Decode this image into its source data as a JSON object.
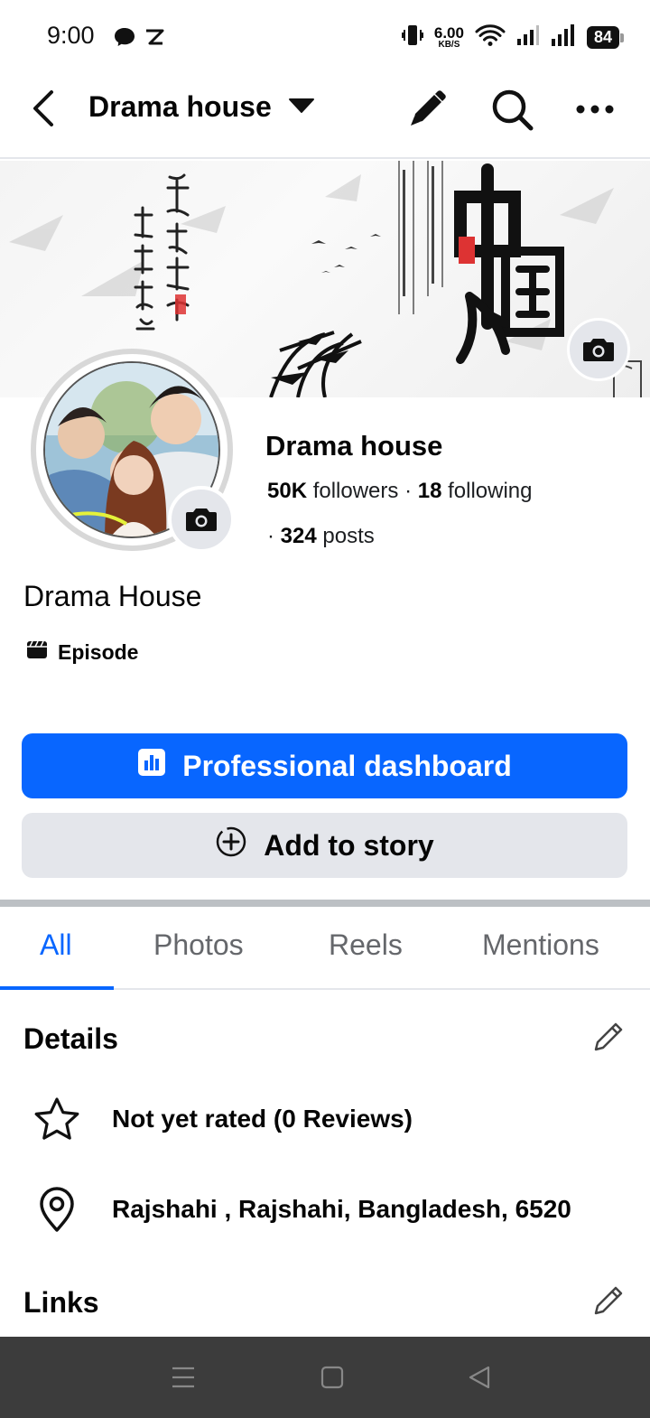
{
  "status_bar": {
    "time": "9:00",
    "net_speed": "6.00",
    "net_unit": "KB/S",
    "battery": "84"
  },
  "app_bar": {
    "title": "Drama house",
    "icons": [
      "back-icon",
      "caret-down-icon",
      "pencil-icon",
      "search-icon",
      "more-icon"
    ]
  },
  "profile": {
    "name": "Drama house",
    "followers_count": "50K",
    "followers_label": " followers · ",
    "following_count": "18",
    "following_label": " following",
    "posts_prefix": "· ",
    "posts_count": "324",
    "posts_label": " posts",
    "display_name": "Drama House",
    "category": "Episode"
  },
  "actions": {
    "primary": "Professional dashboard",
    "secondary": "Add to story"
  },
  "tabs": [
    {
      "label": "All",
      "active": true
    },
    {
      "label": "Photos",
      "active": false
    },
    {
      "label": "Reels",
      "active": false
    },
    {
      "label": "Mentions",
      "active": false
    }
  ],
  "details": {
    "title": "Details",
    "rating": "Not yet rated (0 Reviews)",
    "location": "Rajshahi , Rajshahi, Bangladesh, 6520"
  },
  "links": {
    "title": "Links"
  },
  "colors": {
    "accent": "#0866ff",
    "secondary_button": "#e4e6eb",
    "nav_bar": "#3c3c3c"
  }
}
